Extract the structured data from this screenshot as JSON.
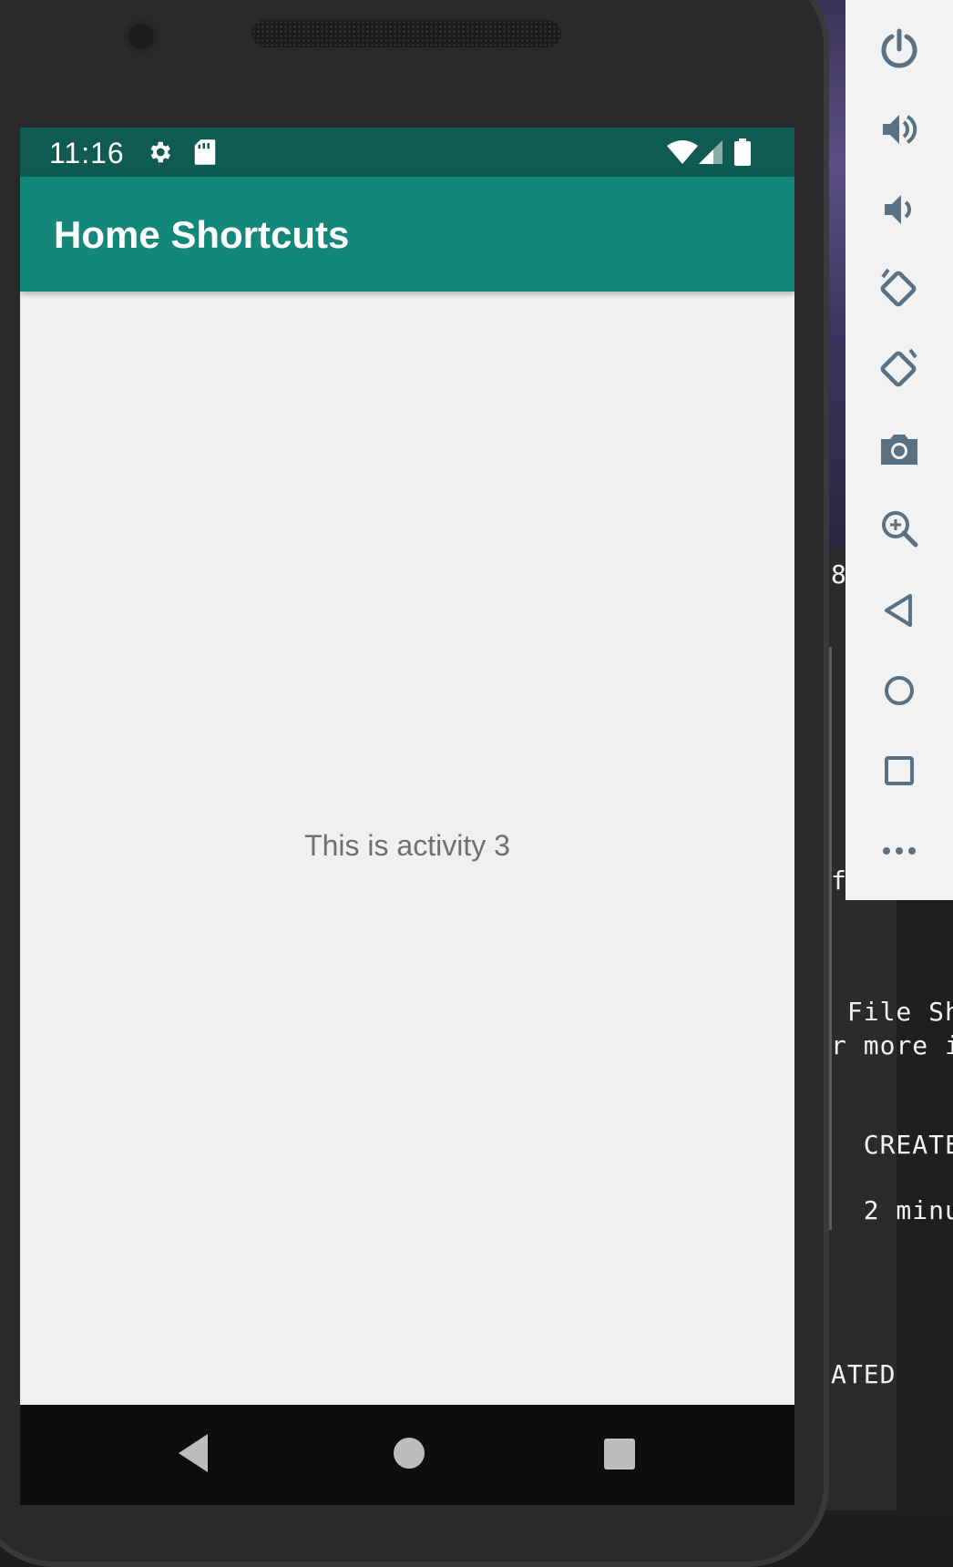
{
  "status_bar": {
    "time": "11:16",
    "icons": [
      "gear-icon",
      "sd-card-icon",
      "wifi-icon",
      "signal-icon",
      "battery-icon"
    ]
  },
  "app_bar": {
    "title": "Home Shortcuts",
    "color": "#12877a",
    "status_color": "#0f5b51"
  },
  "content": {
    "message": "This is activity 3"
  },
  "nav_bar": {
    "buttons": [
      "back-icon",
      "home-icon",
      "recents-icon"
    ]
  },
  "emulator_toolbar": {
    "tools": [
      "power-icon",
      "volume-up-icon",
      "volume-down-icon",
      "rotate-left-icon",
      "rotate-right-icon",
      "camera-icon",
      "zoom-icon",
      "back-icon",
      "home-icon",
      "overview-icon",
      "more-icon"
    ]
  },
  "terminal": {
    "lines": [
      "8",
      "f",
      " File Sh",
      "r more i",
      "  CREATE",
      "  2 minu",
      "ATED"
    ]
  }
}
